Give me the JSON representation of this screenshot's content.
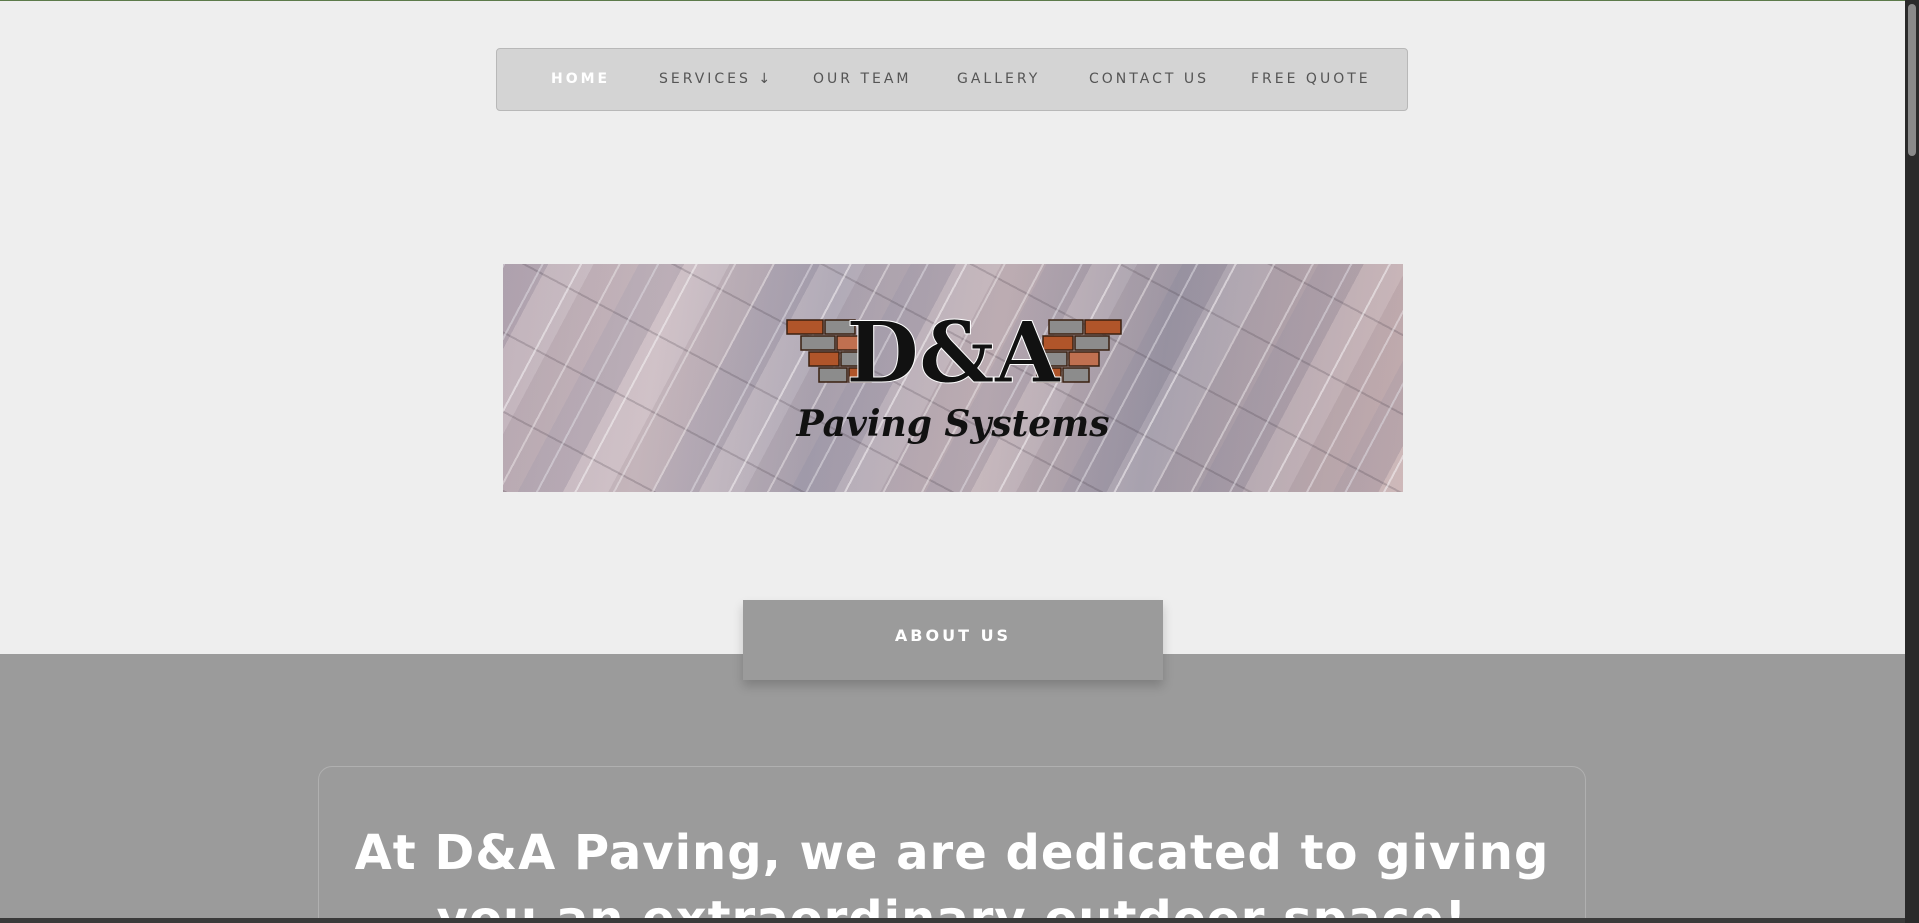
{
  "nav": {
    "items": [
      {
        "label": "HOME",
        "active": true
      },
      {
        "label": "SERVICES ↓",
        "active": false
      },
      {
        "label": "OUR TEAM",
        "active": false
      },
      {
        "label": "GALLERY",
        "active": false
      },
      {
        "label": "CONTACT US",
        "active": false
      },
      {
        "label": "FREE QUOTE",
        "active": false
      }
    ]
  },
  "hero": {
    "logo_main": "D&A",
    "logo_sub": "Paving Systems"
  },
  "about": {
    "tab_label": "ABOUT US",
    "headline": "At D&A Paving, we are dedicated to giving you an extraordinary outdoor space!"
  },
  "colors": {
    "page_bg": "#eeeeee",
    "nav_bg": "#d4d4d4",
    "band_bg": "#9b9b9b",
    "brick_orange": "#b0552a",
    "brick_gray": "#8c8c8c"
  }
}
